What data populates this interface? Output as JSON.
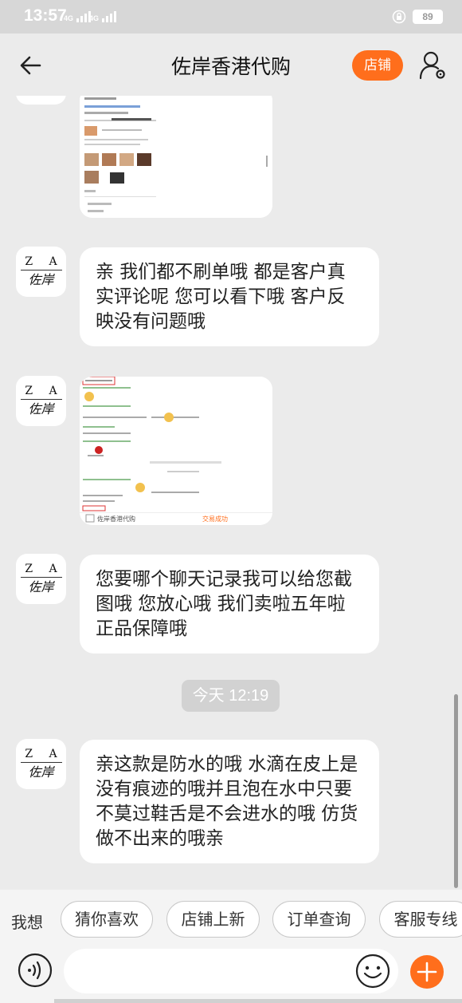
{
  "status_bar": {
    "time": "13:57",
    "network1": "4G",
    "network2": "4G",
    "battery": "89"
  },
  "header": {
    "title": "佐岸香港代购",
    "shop_label": "店铺"
  },
  "avatar": {
    "line1": "Z A",
    "line2": "佐岸"
  },
  "messages": [
    {
      "type": "text",
      "text": "亲 我们都不刷单哦  都是客户真实评论呢   您可以看下哦  客户反映没有问题哦"
    },
    {
      "type": "image",
      "footer_shop": "佐岸香港代购",
      "footer_status": "交易成功"
    },
    {
      "type": "text",
      "text": "您要哪个聊天记录我可以给您截图哦 您放心哦  我们卖啦五年啦  正品保障哦"
    },
    {
      "type": "text",
      "text": "亲这款是防水的哦 水滴在皮上是没有痕迹的哦并且泡在水中只要不莫过鞋舌是不会进水的哦 仿货做不出来的哦亲"
    }
  ],
  "timestamp": "今天  12:19",
  "quick_bar": {
    "label": "我想",
    "chips": [
      "猜你喜欢",
      "店铺上新",
      "订单查询",
      "客服专线"
    ]
  },
  "input": {
    "placeholder": ""
  },
  "colors": {
    "accent": "#ff6e1c",
    "background": "#ebebeb",
    "bubble": "#ffffff"
  }
}
